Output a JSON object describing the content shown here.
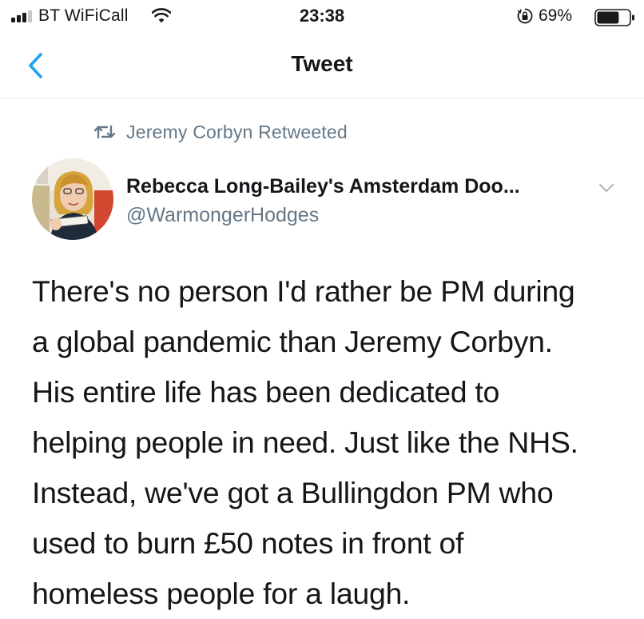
{
  "status_bar": {
    "carrier": "BT WiFiCall",
    "time": "23:38",
    "battery_percent": "69%",
    "battery_level": 0.69,
    "icons": [
      "signal-bars-icon",
      "wifi-icon",
      "orientation-lock-icon",
      "battery-icon"
    ]
  },
  "nav": {
    "title": "Tweet",
    "back_icon": "chevron-left-icon"
  },
  "retweet": {
    "label": "Jeremy Corbyn Retweeted",
    "icon": "retweet-icon"
  },
  "author": {
    "display_name": "Rebecca Long-Bailey's Amsterdam Doo...",
    "handle": "@WarmongerHodges",
    "menu_icon": "chevron-down-icon"
  },
  "tweet": {
    "lines": [
      "There's no person I'd rather be PM during",
      "a global pandemic than Jeremy Corbyn.",
      "His entire life has been dedicated to",
      "helping people in need. Just like the NHS.",
      "Instead, we've got a Bullingdon PM who",
      "used to burn £50 notes in front of",
      "homeless people for a laugh."
    ]
  },
  "colors": {
    "accent": "#1da1f2",
    "secondary_text": "#657786",
    "primary_text": "#14171a",
    "divider": "#e1e8ed"
  }
}
